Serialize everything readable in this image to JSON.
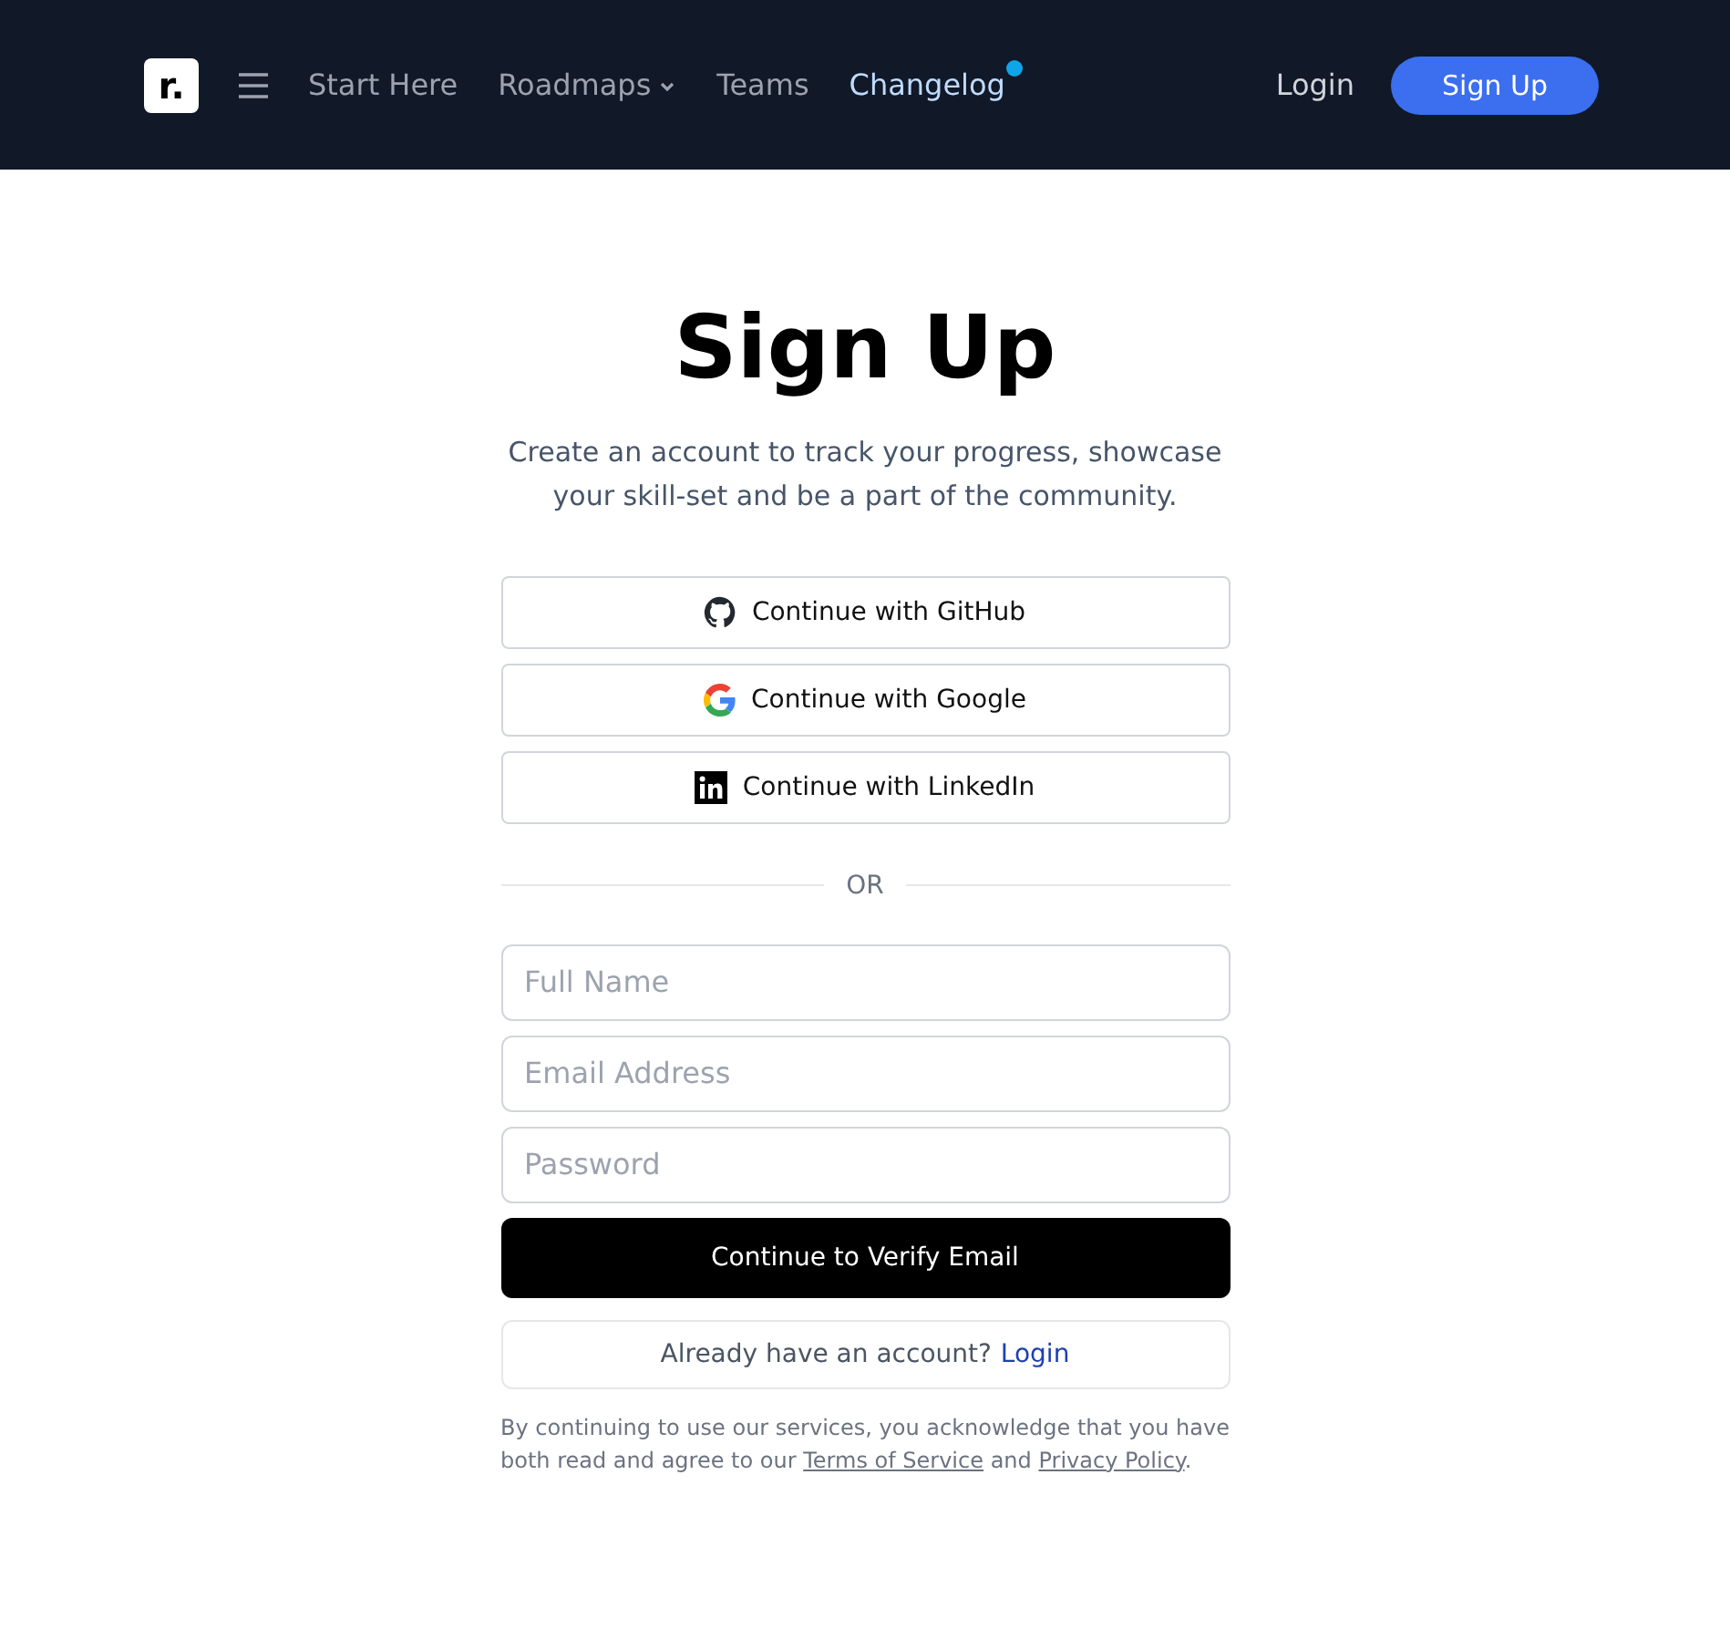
{
  "header": {
    "logo": "r.",
    "nav": [
      {
        "label": "Start Here",
        "dropdown": false,
        "highlighted": false,
        "dot": false
      },
      {
        "label": "Roadmaps",
        "dropdown": true,
        "highlighted": false,
        "dot": false
      },
      {
        "label": "Teams",
        "dropdown": false,
        "highlighted": false,
        "dot": false
      },
      {
        "label": "Changelog",
        "dropdown": false,
        "highlighted": true,
        "dot": true
      }
    ],
    "login": "Login",
    "signup": "Sign Up"
  },
  "title": "Sign Up",
  "subtitle": "Create an account to track your progress, showcase your skill-set and be a part of the community.",
  "providers": [
    {
      "kind": "github",
      "label": "Continue with GitHub"
    },
    {
      "kind": "google",
      "label": "Continue with Google"
    },
    {
      "kind": "linkedin",
      "label": "Continue with LinkedIn"
    }
  ],
  "divider": "OR",
  "fields": [
    {
      "placeholder": "Full Name"
    },
    {
      "placeholder": "Email Address"
    },
    {
      "placeholder": "Password"
    }
  ],
  "submit": "Continue to Verify Email",
  "login_prompt": {
    "text": "Already have an account?",
    "link": "Login"
  },
  "legal": {
    "before": "By continuing to use our services, you acknowledge that you have both read and agree to our",
    "terms": "Terms of Service",
    "middle": "and",
    "privacy": "Privacy Policy",
    "after": "."
  }
}
